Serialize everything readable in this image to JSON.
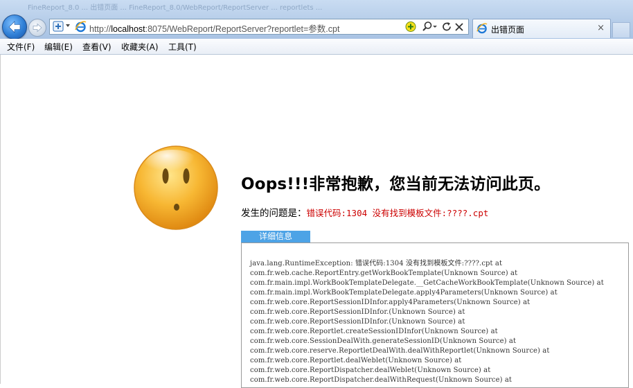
{
  "browser": {
    "ghost_title": "FineReport_8.0 ... 出错页面 ... FineReport_8.0/WebReport/ReportServer ... reportlets ...",
    "url_prefix": "http://",
    "url_host": "localhost",
    "url_rest": ":8075/WebReport/ReportServer?reportlet=参数.cpt",
    "tab_title": "出错页面",
    "tab_close": "×"
  },
  "menu": {
    "items": [
      {
        "label": "文件(F)"
      },
      {
        "label": "编辑(E)"
      },
      {
        "label": "查看(V)"
      },
      {
        "label": "收藏夹(A)"
      },
      {
        "label": "工具(T)"
      }
    ]
  },
  "error": {
    "title": "Oops!!!非常抱歉，您当前无法访问此页。",
    "problem_label": "发生的问题是：",
    "problem_msg": "错误代码:1304 没有找到模板文件:????.cpt",
    "detail_tab": "详细信息",
    "stack": [
      "java.lang.RuntimeException: 错误代码:1304 没有找到模板文件:????.cpt at",
      "com.fr.web.cache.ReportEntry.getWorkBookTemplate(Unknown Source) at",
      "com.fr.main.impl.WorkBookTemplateDelegate.__GetCacheWorkBookTemplate(Unknown Source) at",
      "com.fr.main.impl.WorkBookTemplateDelegate.apply4Parameters(Unknown Source) at",
      "com.fr.web.core.ReportSessionIDInfor.apply4Parameters(Unknown Source) at",
      "com.fr.web.core.ReportSessionIDInfor.(Unknown Source) at",
      "com.fr.web.core.ReportSessionIDInfor.(Unknown Source) at",
      "com.fr.web.core.Reportlet.createSessionIDInfor(Unknown Source) at",
      "com.fr.web.core.SessionDealWith.generateSessionID(Unknown Source) at",
      "com.fr.web.core.reserve.ReportletDealWith.dealWithReportlet(Unknown Source) at",
      "com.fr.web.core.Reportlet.dealWeblet(Unknown Source) at",
      "com.fr.web.core.ReportDispatcher.dealWeblet(Unknown Source) at",
      "com.fr.web.core.ReportDispatcher.dealWithRequest(Unknown Source) at"
    ]
  },
  "colors": {
    "accent_blue": "#4da3e6",
    "error_red": "#cc0000",
    "face_yellow": "#f7b733"
  }
}
